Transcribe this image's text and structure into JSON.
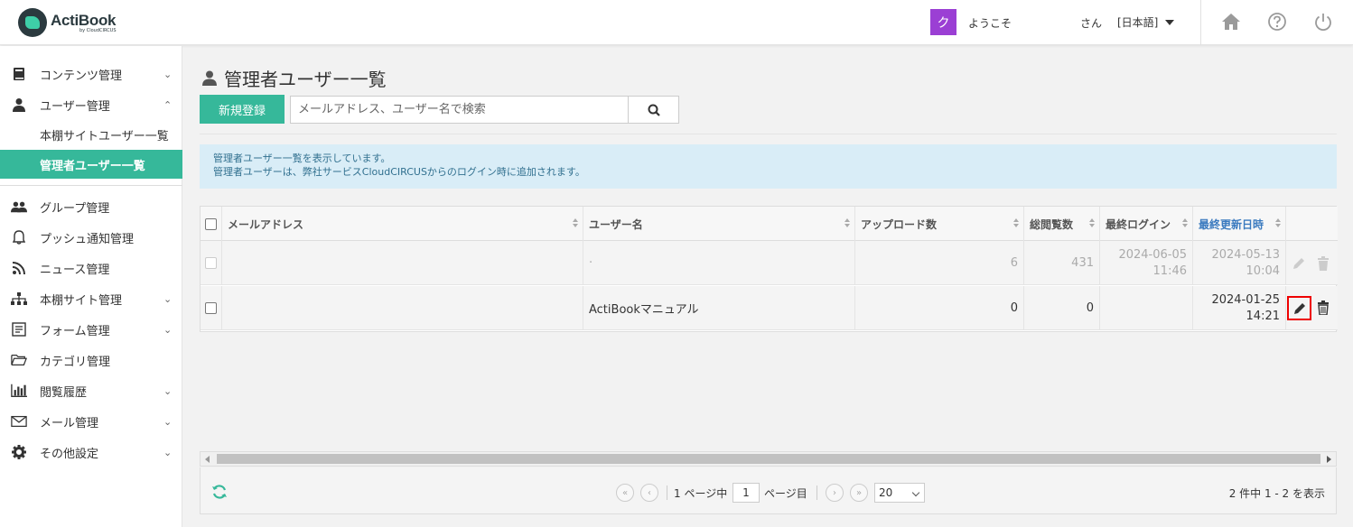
{
  "header": {
    "logo_title": "ActiBook",
    "logo_sub": "by CloudCIRCUS",
    "user_badge": "ク",
    "welcome": "ようこそ",
    "san": "さん",
    "language": "[日本語]",
    "icons": [
      "home-icon",
      "help-icon",
      "power-icon"
    ]
  },
  "sidebar": {
    "items": [
      {
        "label": "コンテンツ管理",
        "icon": "book-icon",
        "chevron": "⌄"
      },
      {
        "label": "ユーザー管理",
        "icon": "user-icon",
        "chevron": "⌃"
      },
      {
        "label": "本棚サイトユーザー一覧"
      },
      {
        "label": "管理者ユーザー一覧"
      },
      {
        "label": "グループ管理",
        "icon": "group-icon"
      },
      {
        "label": "プッシュ通知管理",
        "icon": "bell-icon"
      },
      {
        "label": "ニュース管理",
        "icon": "rss-icon"
      },
      {
        "label": "本棚サイト管理",
        "icon": "sitemap-icon",
        "chevron": "⌄"
      },
      {
        "label": "フォーム管理",
        "icon": "form-icon",
        "chevron": "⌄"
      },
      {
        "label": "カテゴリ管理",
        "icon": "folder-icon"
      },
      {
        "label": "閲覧履歴",
        "icon": "bar-chart-icon",
        "chevron": "⌄"
      },
      {
        "label": "メール管理",
        "icon": "mail-icon",
        "chevron": "⌄"
      },
      {
        "label": "その他設定",
        "icon": "gear-icon",
        "chevron": "⌄"
      }
    ]
  },
  "main": {
    "title": "管理者ユーザー一覧",
    "new_button": "新規登録",
    "search_placeholder": "メールアドレス、ユーザー名で検索",
    "info_line1": "管理者ユーザー一覧を表示しています。",
    "info_line2": "管理者ユーザーは、弊社サービスCloudCIRCUSからのログイン時に追加されます。"
  },
  "table": {
    "columns": [
      "メールアドレス",
      "ユーザー名",
      "アップロード数",
      "総閲覧数",
      "最終ログイン",
      "最終更新日時"
    ],
    "rows": [
      {
        "email": "",
        "username": "·",
        "uploads": "6",
        "views": "431",
        "last_login_date": "2024-06-05",
        "last_login_time": "11:46",
        "updated_date": "2024-05-13",
        "updated_time": "10:04"
      },
      {
        "email": "",
        "username": "ActiBookマニュアル",
        "uploads": "0",
        "views": "0",
        "last_login_date": "",
        "last_login_time": "",
        "updated_date": "2024-01-25",
        "updated_time": "14:21"
      }
    ]
  },
  "pager": {
    "page_prefix": "1 ページ中",
    "current_page": "1",
    "page_suffix": "ページ目",
    "page_size": "20",
    "summary": "2 件中 1 - 2 を表示"
  }
}
